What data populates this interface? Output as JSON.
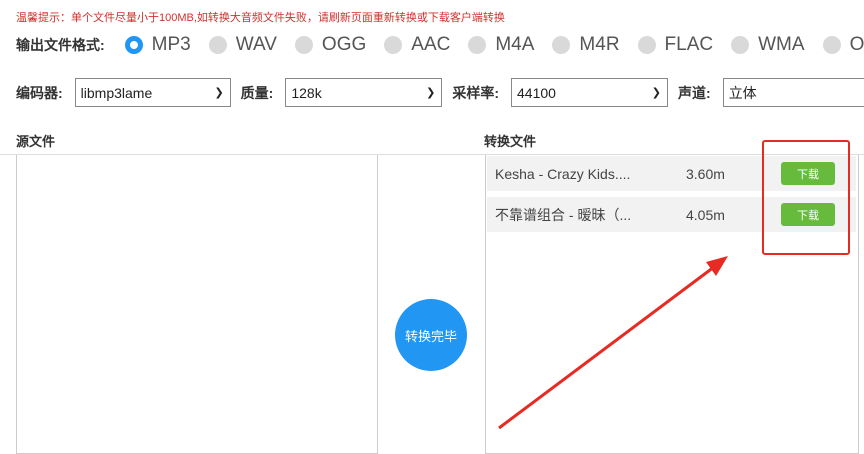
{
  "tip": "温馨提示：单个文件尽量小于100MB,如转换大音频文件失败，请刷新页面重新转换或下载客户端转换",
  "format": {
    "label": "输出文件格式:",
    "options": [
      "MP3",
      "WAV",
      "OGG",
      "AAC",
      "M4A",
      "M4R",
      "FLAC",
      "WMA",
      "OPUS"
    ],
    "selected": "MP3"
  },
  "settings": {
    "encoder": {
      "label": "编码器:",
      "value": "libmp3lame"
    },
    "quality": {
      "label": "质量:",
      "value": "128k"
    },
    "samplerate": {
      "label": "采样率:",
      "value": "44100"
    },
    "channel": {
      "label": "声道:",
      "value": "立体"
    }
  },
  "source_title": "源文件",
  "converted_title": "转换文件",
  "status_button": "转换完毕",
  "files": [
    {
      "name": "Kesha - Crazy Kids....",
      "size": "3.60m",
      "action": "下载"
    },
    {
      "name": "不靠谱组合 - 暧昧（...",
      "size": "4.05m",
      "action": "下载"
    }
  ],
  "colors": {
    "accent": "#2196f3",
    "download": "#66bb3c",
    "tip": "#d0312d",
    "annotation": "#e52b22"
  }
}
